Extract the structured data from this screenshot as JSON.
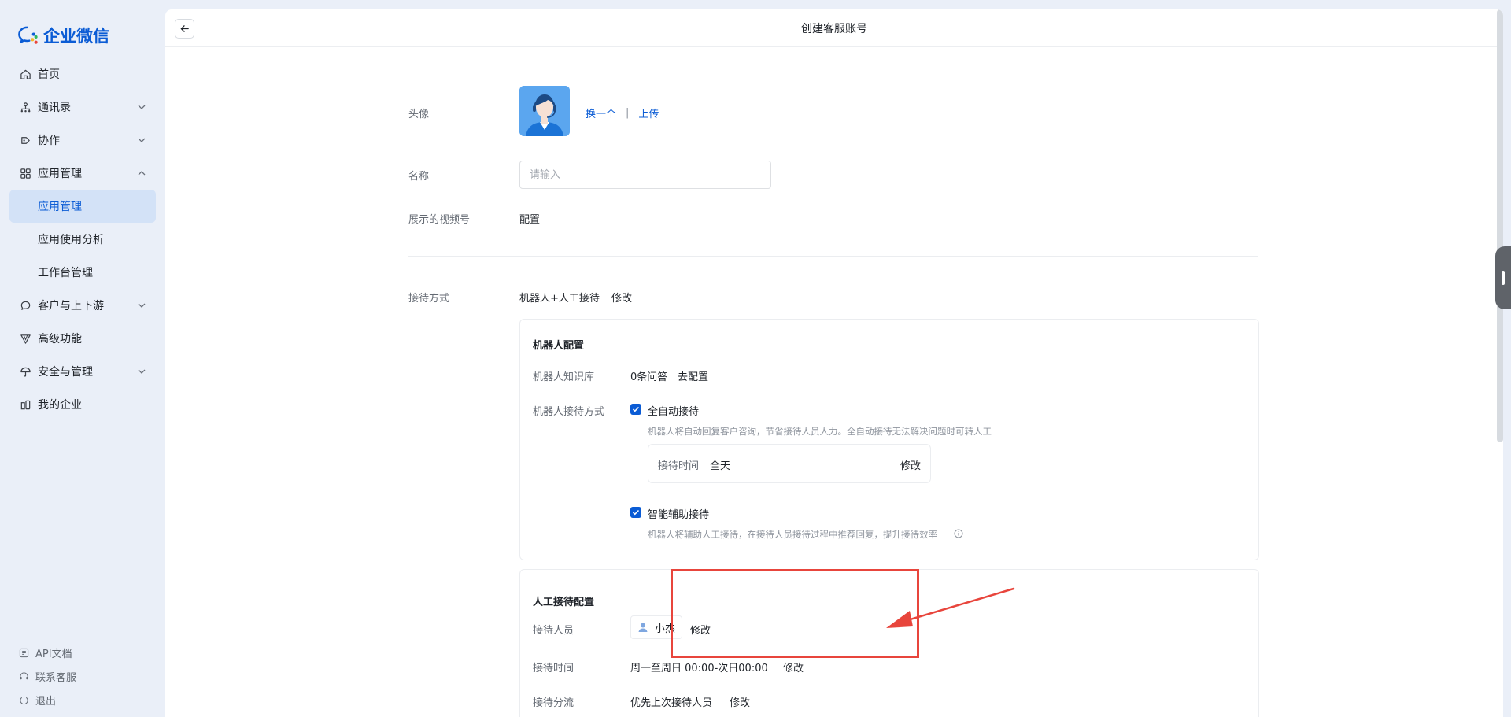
{
  "app": {
    "name": "企业微信"
  },
  "sidebar": {
    "items": [
      {
        "label": "首页",
        "icon": "home-icon"
      },
      {
        "label": "通讯录",
        "icon": "org-icon"
      },
      {
        "label": "协作",
        "icon": "collab-icon"
      },
      {
        "label": "应用管理",
        "icon": "apps-icon"
      },
      {
        "label": "应用管理",
        "icon": ""
      },
      {
        "label": "应用使用分析",
        "icon": ""
      },
      {
        "label": "工作台管理",
        "icon": ""
      },
      {
        "label": "客户与上下游",
        "icon": "chat-icon"
      },
      {
        "label": "高级功能",
        "icon": "advanced-icon"
      },
      {
        "label": "安全与管理",
        "icon": "umbrella-icon"
      },
      {
        "label": "我的企业",
        "icon": "building-icon"
      }
    ],
    "footer": [
      {
        "label": "API文档",
        "icon": "api-doc-icon"
      },
      {
        "label": "联系客服",
        "icon": "headset-icon"
      },
      {
        "label": "退出",
        "icon": "power-icon"
      }
    ]
  },
  "header": {
    "title": "创建客服账号"
  },
  "form": {
    "avatar_label": "头像",
    "avatar_change": "换一个",
    "avatar_sep": "|",
    "avatar_upload": "上传",
    "name_label": "名称",
    "name_placeholder": "请输入",
    "video_label": "展示的视频号",
    "video_link": "配置",
    "reception_label": "接待方式",
    "reception_value": "机器人+人工接待",
    "reception_edit": "修改"
  },
  "robot": {
    "title": "机器人配置",
    "kb_label": "机器人知识库",
    "kb_value": "0条问答",
    "kb_link": "去配置",
    "mode_label": "机器人接待方式",
    "auto_label": "全自动接待",
    "auto_hint": "机器人将自动回复客户咨询，节省接待人员人力。全自动接待无法解决问题时可转人工",
    "time_label": "接待时间",
    "time_value": "全天",
    "time_edit": "修改",
    "assist_label": "智能辅助接待",
    "assist_hint": "机器人将辅助人工接待，在接待人员接待过程中推荐回复，提升接待效率"
  },
  "manual": {
    "title": "人工接待配置",
    "staff_label": "接待人员",
    "staff_name": "小杰",
    "staff_edit": "修改",
    "time_label": "接待时间",
    "time_value": "周一至周日 00:00-次日00:00",
    "time_edit": "修改",
    "route_label": "接待分流",
    "route_value": "优先上次接待人员",
    "route_edit": "修改"
  },
  "colors": {
    "accent": "#0b5cd5",
    "annotation": "#e8453c"
  }
}
